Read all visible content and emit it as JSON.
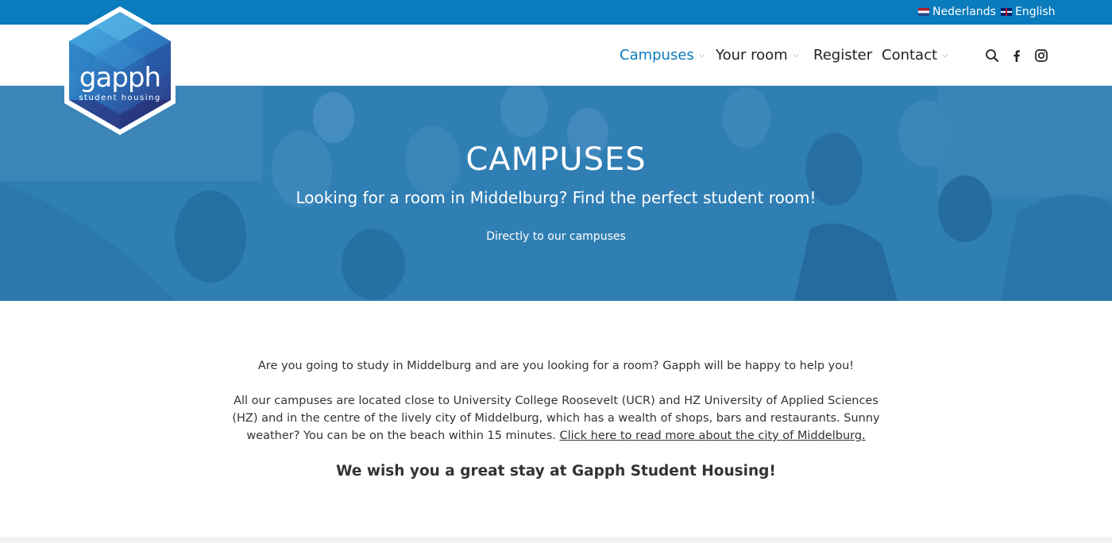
{
  "language_bar": {
    "dutch_label": "Nederlands",
    "english_label": "English"
  },
  "logo": {
    "name": "gapph",
    "tagline": "student housing"
  },
  "nav": {
    "campuses": "Campuses",
    "your_room": "Your room",
    "register": "Register",
    "contact": "Contact"
  },
  "icons": [
    "search-icon",
    "facebook-icon",
    "instagram-icon",
    "chevron-down-icon"
  ],
  "colors": {
    "brand_blue": "#0a7bbd",
    "hero_overlay": "#2f7aab",
    "text": "#333333"
  },
  "hero": {
    "title": "CAMPUSES",
    "subtitle": "Looking for a room in Middelburg? Find the perfect student room!",
    "link": "Directly to our campuses"
  },
  "content": {
    "intro": "Are you going to study in Middelburg and are you looking for a room? Gapph will be happy to help you!",
    "body": "All our campuses are located close to University College Roosevelt (UCR) and HZ University of Applied Sciences (HZ) and in the centre of the lively city of Middelburg, which has a wealth of shops, bars and restaurants. Sunny weather? You can be on the beach within 15 minutes.",
    "body_link": "Click here to read more about the city of Middelburg.",
    "closing": "We wish you a great stay at Gapph Student Housing!"
  }
}
